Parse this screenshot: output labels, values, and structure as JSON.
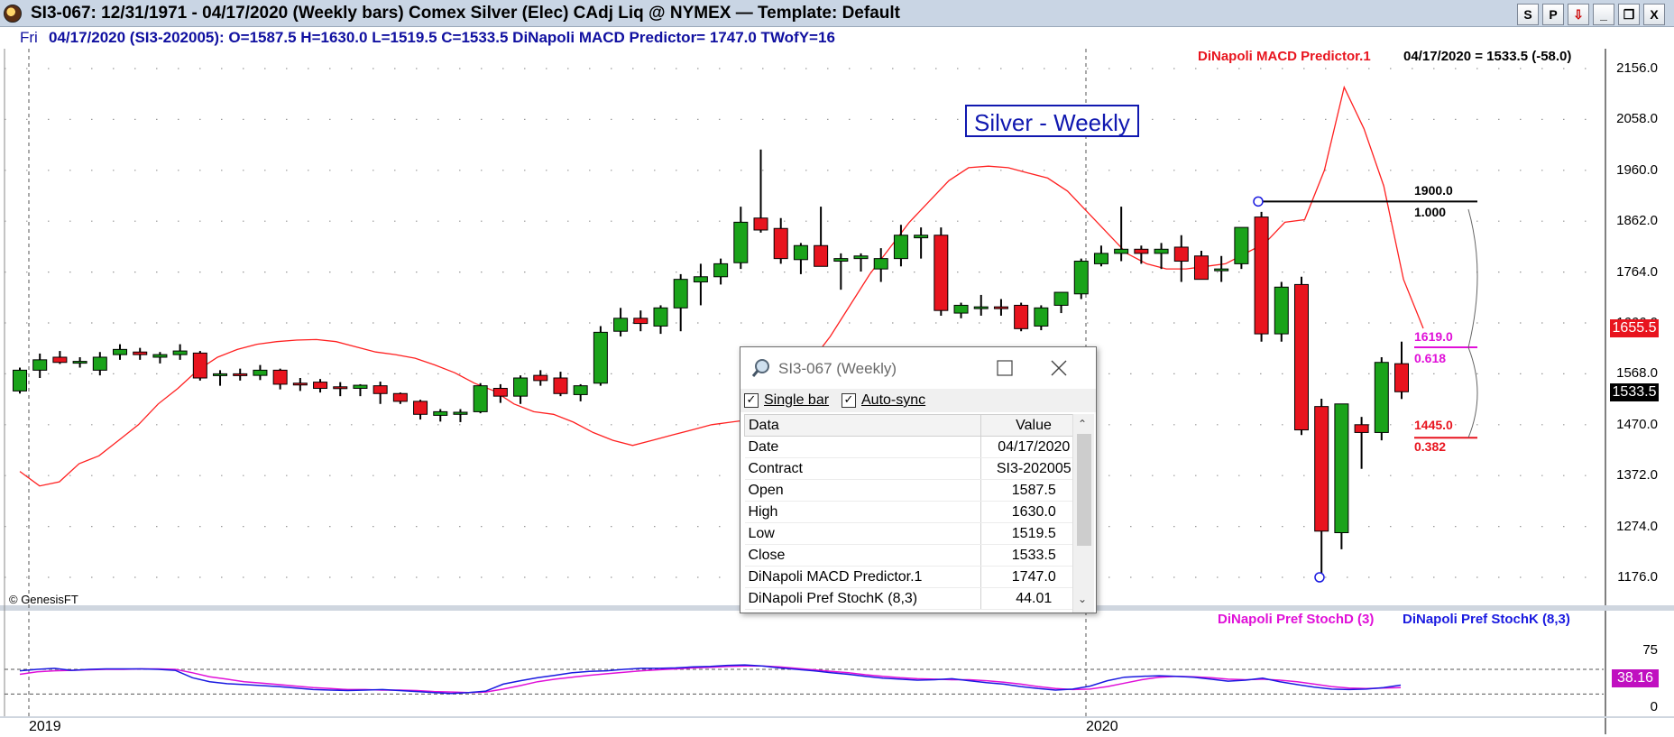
{
  "window": {
    "title": "SI3-067:  12/31/1971 - 04/17/2020  (Weekly bars)   Comex Silver (Elec) CAdj Liq @ NYMEX  —  Template: Default",
    "buttons": [
      "S",
      "P",
      "⇩",
      "_",
      "❐",
      "X"
    ]
  },
  "infobar": {
    "day": "Fri",
    "text": "04/17/2020 (SI3-202005):  O=1587.5  H=1630.0  L=1519.5  C=1533.5  DiNapoli MACD Predictor= 1747.0  TWofY=16"
  },
  "overlay": {
    "indicator_label": "DiNapoli MACD Predictor.1",
    "indicator_value": "04/17/2020 = 1533.5 (-58.0)",
    "chart_title": "Silver - Weekly",
    "copyright": "© GenesisFT",
    "macd_box": "1655.5",
    "last_box": "1533.5",
    "fib": [
      {
        "price": "1900.0",
        "ratio": "1.000"
      },
      {
        "price": "1619.0",
        "ratio": "0.618"
      },
      {
        "price": "1445.0",
        "ratio": "0.382"
      }
    ]
  },
  "colors": {
    "up": "#1aa31a",
    "down": "#e8141e",
    "macd": "#ff2020",
    "stochK": "#1a1ae0",
    "stochD": "#e010d8",
    "title_blue": "#1018b0"
  },
  "price_axis": [
    "2156.0",
    "2058.0",
    "1960.0",
    "1862.0",
    "1764.0",
    "1666.0",
    "1568.0",
    "1470.0",
    "1372.0",
    "1274.0",
    "1176.0"
  ],
  "stoch_axis": [
    "75",
    "0"
  ],
  "stoch": {
    "d_label": "DiNapoli Pref StochD (3)",
    "k_label": "DiNapoli Pref StochK (8,3)",
    "value_box": "38.16",
    "K": [
      72,
      75,
      77,
      73,
      75,
      76,
      76,
      76,
      75,
      73,
      58,
      50,
      46,
      44,
      42,
      40,
      37,
      34,
      33,
      32,
      33,
      34,
      32,
      30,
      28,
      26,
      28,
      31,
      45,
      52,
      58,
      63,
      68,
      71,
      72,
      75,
      77,
      77,
      78,
      80,
      81,
      83,
      84,
      82,
      78,
      75,
      72,
      68,
      65,
      61,
      57,
      55,
      53,
      54,
      56,
      52,
      48,
      45,
      40,
      36,
      33,
      35,
      41,
      52,
      59,
      61,
      62,
      61,
      59,
      55,
      51,
      53,
      57,
      50,
      44,
      39,
      35,
      34,
      35,
      38,
      43
    ],
    "D": [
      65,
      70,
      72,
      73,
      74,
      75,
      75,
      76,
      76,
      75,
      68,
      60,
      55,
      50,
      47,
      44,
      41,
      38,
      36,
      34,
      34,
      33,
      33,
      32,
      30,
      29,
      28,
      29,
      35,
      42,
      50,
      55,
      59,
      63,
      66,
      69,
      72,
      74,
      76,
      78,
      79,
      81,
      82,
      82,
      80,
      77,
      74,
      71,
      68,
      64,
      61,
      58,
      56,
      55,
      54,
      54,
      52,
      49,
      45,
      40,
      36,
      34,
      35,
      40,
      47,
      54,
      59,
      61,
      60,
      58,
      55,
      54,
      55,
      53,
      50,
      45,
      40,
      37,
      36,
      37,
      38
    ]
  },
  "x_axis": {
    "years": [
      "2019",
      "2020"
    ]
  },
  "chart_data": {
    "type": "candlestick",
    "title": "Silver - Weekly",
    "ylim": [
      1120,
      2200
    ],
    "ohlc": [
      [
        1535,
        1580,
        1530,
        1575
      ],
      [
        1575,
        1607,
        1560,
        1595
      ],
      [
        1600,
        1612,
        1587,
        1590
      ],
      [
        1590,
        1600,
        1580,
        1592
      ],
      [
        1575,
        1610,
        1565,
        1600
      ],
      [
        1605,
        1625,
        1595,
        1615
      ],
      [
        1610,
        1618,
        1595,
        1605
      ],
      [
        1600,
        1610,
        1588,
        1605
      ],
      [
        1605,
        1625,
        1595,
        1612
      ],
      [
        1608,
        1612,
        1555,
        1560
      ],
      [
        1565,
        1575,
        1545,
        1568
      ],
      [
        1568,
        1578,
        1555,
        1565
      ],
      [
        1565,
        1585,
        1556,
        1575
      ],
      [
        1575,
        1578,
        1538,
        1548
      ],
      [
        1550,
        1560,
        1535,
        1548
      ],
      [
        1552,
        1558,
        1532,
        1540
      ],
      [
        1543,
        1552,
        1525,
        1542
      ],
      [
        1540,
        1548,
        1525,
        1546
      ],
      [
        1545,
        1553,
        1510,
        1530
      ],
      [
        1530,
        1532,
        1510,
        1515
      ],
      [
        1515,
        1518,
        1480,
        1490
      ],
      [
        1488,
        1500,
        1476,
        1495
      ],
      [
        1490,
        1500,
        1475,
        1494
      ],
      [
        1495,
        1550,
        1492,
        1545
      ],
      [
        1540,
        1548,
        1512,
        1525
      ],
      [
        1525,
        1565,
        1510,
        1560
      ],
      [
        1565,
        1575,
        1545,
        1555
      ],
      [
        1560,
        1572,
        1525,
        1530
      ],
      [
        1528,
        1548,
        1515,
        1545
      ],
      [
        1550,
        1660,
        1545,
        1648
      ],
      [
        1650,
        1695,
        1640,
        1675
      ],
      [
        1675,
        1690,
        1650,
        1665
      ],
      [
        1660,
        1700,
        1645,
        1695
      ],
      [
        1695,
        1760,
        1650,
        1750
      ],
      [
        1745,
        1780,
        1700,
        1755
      ],
      [
        1755,
        1790,
        1740,
        1780
      ],
      [
        1782,
        1890,
        1770,
        1860
      ],
      [
        1868,
        2000,
        1840,
        1845
      ],
      [
        1848,
        1868,
        1780,
        1790
      ],
      [
        1788,
        1820,
        1760,
        1815
      ],
      [
        1815,
        1890,
        1780,
        1775
      ],
      [
        1785,
        1800,
        1730,
        1790
      ],
      [
        1790,
        1800,
        1765,
        1795
      ],
      [
        1770,
        1810,
        1745,
        1790
      ],
      [
        1790,
        1855,
        1775,
        1835
      ],
      [
        1830,
        1850,
        1790,
        1835
      ],
      [
        1835,
        1850,
        1680,
        1690
      ],
      [
        1685,
        1705,
        1675,
        1700
      ],
      [
        1695,
        1720,
        1680,
        1697
      ],
      [
        1697,
        1712,
        1680,
        1695
      ],
      [
        1700,
        1705,
        1650,
        1655
      ],
      [
        1660,
        1700,
        1652,
        1695
      ],
      [
        1700,
        1720,
        1685,
        1725
      ],
      [
        1722,
        1790,
        1712,
        1785
      ],
      [
        1780,
        1815,
        1775,
        1800
      ],
      [
        1800,
        1890,
        1785,
        1808
      ],
      [
        1808,
        1815,
        1780,
        1800
      ],
      [
        1800,
        1820,
        1770,
        1808
      ],
      [
        1812,
        1835,
        1745,
        1785
      ],
      [
        1795,
        1805,
        1760,
        1750
      ],
      [
        1770,
        1795,
        1745,
        1770
      ],
      [
        1780,
        1845,
        1770,
        1850
      ],
      [
        1870,
        1880,
        1630,
        1645
      ],
      [
        1645,
        1745,
        1630,
        1735
      ],
      [
        1740,
        1755,
        1450,
        1460
      ],
      [
        1505,
        1520,
        1175,
        1265
      ],
      [
        1262,
        1495,
        1230,
        1510
      ],
      [
        1470,
        1485,
        1385,
        1455
      ],
      [
        1455,
        1600,
        1440,
        1590
      ],
      [
        1587.5,
        1630,
        1519.5,
        1533.5
      ]
    ],
    "macd_predictor": [
      1380,
      1352,
      1360,
      1395,
      1410,
      1440,
      1470,
      1510,
      1540,
      1575,
      1600,
      1615,
      1625,
      1630,
      1633,
      1634,
      1630,
      1620,
      1610,
      1605,
      1598,
      1585,
      1570,
      1550,
      1535,
      1510,
      1495,
      1490,
      1475,
      1455,
      1440,
      1430,
      1440,
      1450,
      1460,
      1470,
      1475,
      1480,
      1500,
      1540,
      1590,
      1640,
      1700,
      1760,
      1810,
      1860,
      1900,
      1940,
      1965,
      1968,
      1965,
      1955,
      1945,
      1920,
      1880,
      1840,
      1800,
      1780,
      1770,
      1770,
      1775,
      1780,
      1800,
      1820,
      1860,
      1865,
      1960,
      2120,
      2040,
      1930,
      1750,
      1655.5
    ]
  }
}
